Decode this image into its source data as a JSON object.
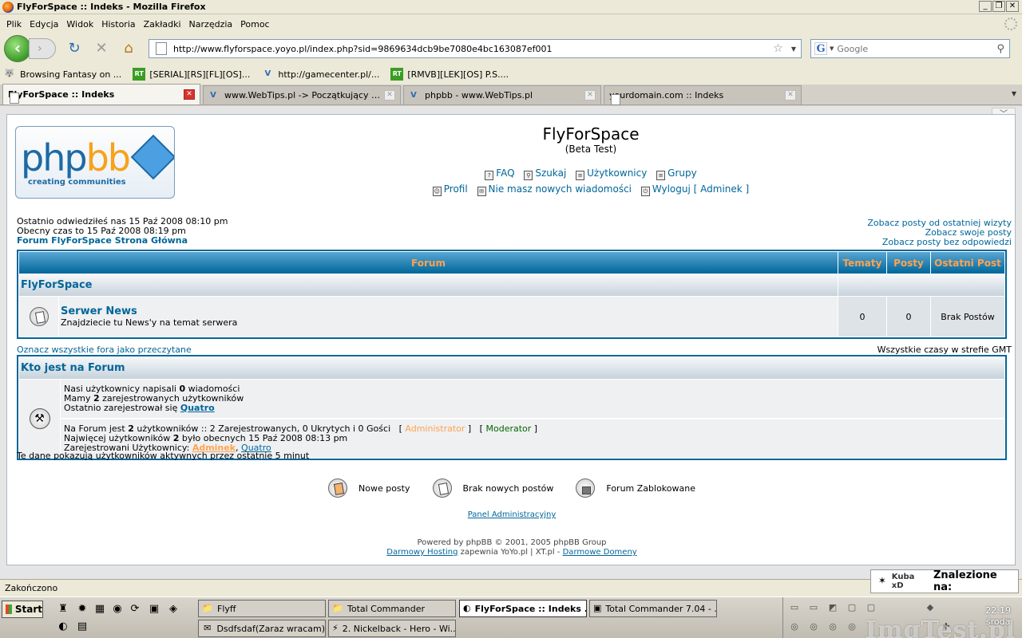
{
  "window": {
    "title": "FlyForSpace :: Indeks - Mozilla Firefox",
    "buttons": [
      "_",
      "❐",
      "✕"
    ]
  },
  "menu": [
    "Plik",
    "Edycja",
    "Widok",
    "Historia",
    "Zakładki",
    "Narzędzia",
    "Pomoc"
  ],
  "nav": {
    "url": "http://www.flyforspace.yoyo.pl/index.php?sid=9869634dcb9be7080e4bc163087ef001",
    "search_placeholder": "Google"
  },
  "bookmarks": [
    {
      "label": "Browsing Fantasy on ...",
      "icon": "wolf-icon"
    },
    {
      "label": "[SERIAL][RS][FL][OS]...",
      "icon": "rt-icon"
    },
    {
      "label": "http://gamecenter.pl/...",
      "icon": "v-icon"
    },
    {
      "label": "[RMVB][LEK][OS] P.S....",
      "icon": "rt-icon"
    }
  ],
  "tabs": [
    {
      "label": "FlyForSpace :: Indeks",
      "active": true
    },
    {
      "label": "www.WebTips.pl -> Początkujący web...",
      "active": false
    },
    {
      "label": "phpbb - www.WebTips.pl",
      "active": false
    },
    {
      "label": "yourdomain.com :: Indeks",
      "active": false
    }
  ],
  "logo": {
    "php": "php",
    "bb": "bb",
    "tagline": "creating   communities"
  },
  "site": {
    "title": "FlyForSpace",
    "description": "(Beta Test)"
  },
  "toplinks": {
    "faq": "FAQ",
    "search": "Szukaj",
    "members": "Użytkownicy",
    "groups": "Grupy",
    "profile": "Profil",
    "messages": "Nie masz nowych wiadomości",
    "logout": "Wyloguj [ Adminek ]"
  },
  "info": {
    "last_visit": "Ostatnio odwiedziłeś nas 15 Paź 2008 08:10 pm",
    "current_time": "Obecny czas to 15 Paź 2008 08:19 pm",
    "index_link": "Forum FlyForSpace Strona Główna",
    "view_newest": "Zobacz posty od ostatniej wizyty",
    "view_own": "Zobacz swoje posty",
    "view_unanswered": "Zobacz posty bez odpowiedzi"
  },
  "forum_table": {
    "headers": {
      "forum": "Forum",
      "topics": "Tematy",
      "posts": "Posty",
      "last_post": "Ostatni Post"
    },
    "category": "FlyForSpace",
    "rows": [
      {
        "name": "Serwer News",
        "description": "Znajdziecie tu News'y na temat serwera",
        "topics": "0",
        "posts": "0",
        "last_post": "Brak Postów"
      }
    ]
  },
  "mark_read": "Oznacz wszystkie fora jako przeczytane",
  "timezone": "Wszystkie czasy w strefie GMT",
  "whois": {
    "title": "Kto jest na Forum",
    "line1_a": "Nasi użytkownicy napisali ",
    "line1_b": "0",
    "line1_c": " wiadomości",
    "line2_a": "Mamy ",
    "line2_b": "2",
    "line2_c": " zarejestrowanych użytkowników",
    "line3_a": "Ostatnio zarejestrował się ",
    "newest_user": "Quatro",
    "online_a": "Na Forum jest ",
    "online_b": "2",
    "online_c": " użytkowników :: 2 Zarejestrowanych, 0 Ukrytych i 0 Gości   [ ",
    "admin_label": "Administrator",
    "online_d": " ]   [ ",
    "mod_label": "Moderator",
    "online_e": " ]",
    "record_a": "Najwięcej użytkowników ",
    "record_b": "2",
    "record_c": " było obecnych 15 Paź 2008 08:13 pm",
    "registered_a": "Zarejestrowani Użytkownicy: ",
    "reg_user1": "Adminek",
    "reg_sep": ", ",
    "reg_user2": "Quatro"
  },
  "active_note": "Te dane pokazują użytkowników aktywnych przez ostatnie 5 minut",
  "legend": {
    "new": "Nowe posty",
    "no_new": "Brak nowych postów",
    "locked": "Forum Zablokowane"
  },
  "admin_panel": "Panel Administracyjny",
  "footer": {
    "powered": "Powered by phpBB © 2001, 2005 phpBB Group",
    "hosting": "Darmowy Hosting",
    "provided": " zapewnia YoYo.pl | XT.pl - ",
    "domains": "Darmowe Domeny"
  },
  "status": "Zakończono",
  "notification": {
    "name": "Kuba xD",
    "label": "Znalezione na:"
  },
  "taskbar": {
    "start": "Start",
    "tasks": [
      {
        "label": "Flyff",
        "icon": "folder-icon"
      },
      {
        "label": "Total Commander",
        "icon": "folder-icon"
      },
      {
        "label": "FlyForSpace :: Indeks ...",
        "icon": "firefox-icon",
        "active": true
      },
      {
        "label": "Total Commander 7.04 - ...",
        "icon": "tc-icon"
      },
      {
        "label": "Dsdfsdaf(Zaraz wracam)",
        "icon": "mail-icon"
      },
      {
        "label": "2. Nickelback - Hero - Wi...",
        "icon": "winamp-icon"
      }
    ],
    "clock": "22:19",
    "day": "środa",
    "watermark": "ImgTest.pl"
  }
}
